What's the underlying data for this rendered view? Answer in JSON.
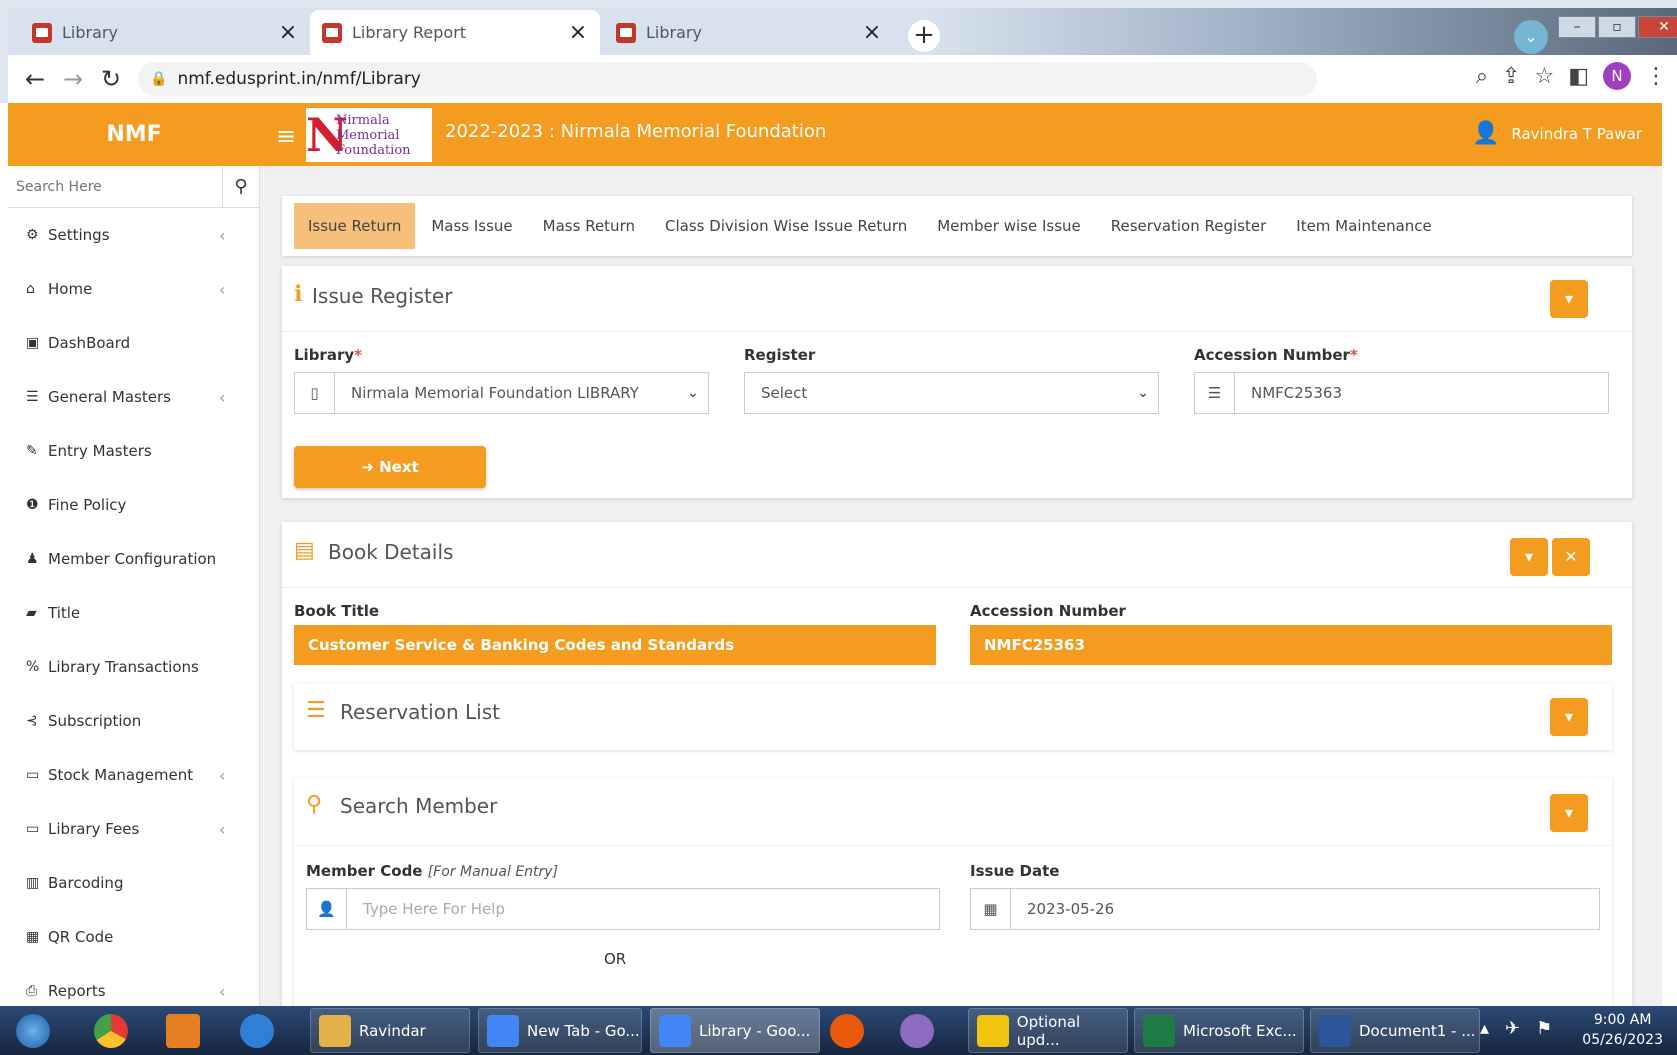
{
  "browser": {
    "tabs": [
      {
        "title": "Library",
        "active": false
      },
      {
        "title": "Library Report",
        "active": true
      },
      {
        "title": "Library",
        "active": false
      }
    ],
    "url": "nmf.edusprint.in/nmf/Library",
    "profile_initial": "N"
  },
  "app": {
    "brand": "NMF",
    "logo_text": [
      "Nirmala",
      "Memorial",
      "Foundation"
    ],
    "header_title": "2022-2023 : Nirmala Memorial Foundation",
    "user_name": "Ravindra T Pawar",
    "accent_color": "#f39c1f"
  },
  "sidebar": {
    "search_placeholder": "Search Here",
    "items": [
      {
        "label": "Settings",
        "icon": "gears-icon",
        "chevron": true
      },
      {
        "label": "Home",
        "icon": "home-icon",
        "chevron": true
      },
      {
        "label": "DashBoard",
        "icon": "dashboard-icon",
        "chevron": false
      },
      {
        "label": "General Masters",
        "icon": "list-icon",
        "chevron": true
      },
      {
        "label": "Entry Masters",
        "icon": "edit-icon",
        "chevron": false
      },
      {
        "label": "Fine Policy",
        "icon": "info-icon",
        "chevron": false
      },
      {
        "label": "Member Configuration",
        "icon": "user-icon",
        "chevron": false
      },
      {
        "label": "Title",
        "icon": "book-icon",
        "chevron": false
      },
      {
        "label": "Library Transactions",
        "icon": "percent-icon",
        "chevron": false
      },
      {
        "label": "Subscription",
        "icon": "rss-icon",
        "chevron": false
      },
      {
        "label": "Stock Management",
        "icon": "inbox-icon",
        "chevron": true
      },
      {
        "label": "Library Fees",
        "icon": "money-icon",
        "chevron": true
      },
      {
        "label": "Barcoding",
        "icon": "barcode-icon",
        "chevron": false
      },
      {
        "label": "QR Code",
        "icon": "qrcode-icon",
        "chevron": false
      },
      {
        "label": "Reports",
        "icon": "print-icon",
        "chevron": true
      }
    ]
  },
  "tabs": [
    "Issue Return",
    "Mass Issue",
    "Mass Return",
    "Class Division Wise Issue Return",
    "Member wise Issue",
    "Reservation Register",
    "Item Maintenance"
  ],
  "issue_register": {
    "title": "Issue Register",
    "library_label": "Library",
    "library_value": "Nirmala Memorial Foundation LIBRARY",
    "register_label": "Register",
    "register_value": "Select",
    "accession_label": "Accession Number",
    "accession_value": "NMFC25363",
    "next_label": "Next"
  },
  "book_details": {
    "title": "Book Details",
    "book_title_label": "Book Title",
    "book_title_value": "Customer Service & Banking Codes and Standards",
    "accession_label": "Accession Number",
    "accession_value": "NMFC25363"
  },
  "reservation": {
    "title": "Reservation List"
  },
  "search_member": {
    "title": "Search Member",
    "member_code_label": "Member Code",
    "member_code_hint": "[For Manual Entry]",
    "member_code_placeholder": "Type Here For Help",
    "issue_date_label": "Issue Date",
    "issue_date_value": "2023-05-26",
    "or_text": "OR"
  },
  "taskbar": {
    "tasks": [
      "Ravindar",
      "New Tab - Go...",
      "Library - Goo...",
      "Optional upd...",
      "Microsoft Exc...",
      "Document1 - ..."
    ],
    "time": "9:00 AM",
    "date": "05/26/2023"
  }
}
